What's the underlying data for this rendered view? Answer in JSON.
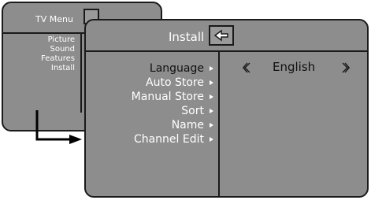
{
  "tv_menu": {
    "title": "TV Menu",
    "items": [
      {
        "label": "Picture"
      },
      {
        "label": "Sound"
      },
      {
        "label": "Features"
      },
      {
        "label": "Install"
      }
    ]
  },
  "install_menu": {
    "title": "Install",
    "items": [
      {
        "label": "Language",
        "selected": true
      },
      {
        "label": "Auto Store"
      },
      {
        "label": "Manual Store"
      },
      {
        "label": "Sort"
      },
      {
        "label": "Name"
      },
      {
        "label": "Channel Edit"
      }
    ],
    "current_value": "English"
  },
  "icons": {
    "menu_icon": "menu-document-icon",
    "install_icon": "install-document-icon",
    "arrow_left": "double-chevron-left-icon",
    "arrow_right": "double-chevron-right-icon",
    "submenu": "triangle-right-icon"
  },
  "colors": {
    "panel": "#8d8d8d",
    "border": "#1a1a1a",
    "text_normal": "#ffffff",
    "text_selected": "#111111"
  }
}
